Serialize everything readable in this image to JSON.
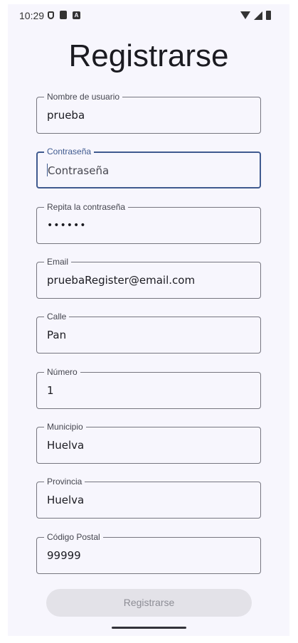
{
  "status_bar": {
    "time": "10:29",
    "icons_left": [
      "shield-icon",
      "sim-icon",
      "a-icon"
    ],
    "icons_right": [
      "wifi-icon",
      "signal-icon",
      "battery-icon"
    ]
  },
  "title": "Registrarse",
  "fields": [
    {
      "label": "Nombre de usuario",
      "value": "prueba",
      "focused": false
    },
    {
      "label": "Contraseña",
      "value": "Contraseña",
      "placeholder": "Contraseña",
      "focused": true
    },
    {
      "label": "Repita la contraseña",
      "value": "••••••",
      "focused": false
    },
    {
      "label": "Email",
      "value": "pruebaRegister@email.com",
      "focused": false
    },
    {
      "label": "Calle",
      "value": "Pan",
      "focused": false
    },
    {
      "label": "Número",
      "value": "1",
      "focused": false
    },
    {
      "label": "Municipio",
      "value": "Huelva",
      "focused": false
    },
    {
      "label": "Provincia",
      "value": "Huelva",
      "focused": false
    },
    {
      "label": "Código Postal",
      "value": "99999",
      "focused": false
    }
  ],
  "register_button": {
    "label": "Registrarse",
    "enabled": false
  },
  "colors": {
    "background": "#f7f6fd",
    "outline": "#76767f",
    "focus": "#3f5a8f",
    "button_disabled_bg": "#e3e2e8",
    "button_disabled_text": "#8d8d95"
  }
}
